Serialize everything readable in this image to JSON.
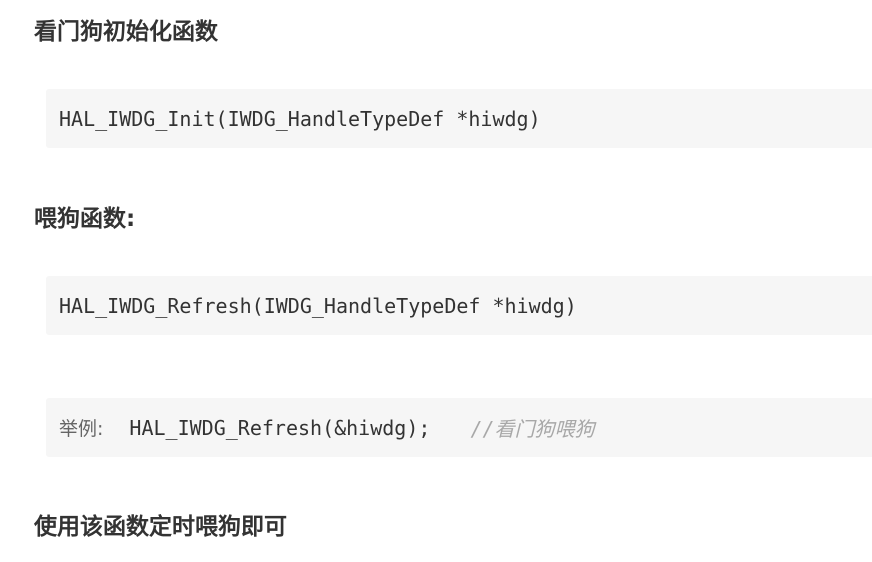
{
  "sections": {
    "init_heading": "看门狗初始化函数",
    "init_code": "HAL_IWDG_Init(IWDG_HandleTypeDef *hiwdg)",
    "refresh_heading": "喂狗函数:",
    "refresh_code": "HAL_IWDG_Refresh(IWDG_HandleTypeDef *hiwdg)",
    "example_label": "举例:",
    "example_code": "HAL_IWDG_Refresh(&hiwdg);",
    "example_comment": "//看门狗喂狗",
    "usage_note": "使用该函数定时喂狗即可"
  }
}
